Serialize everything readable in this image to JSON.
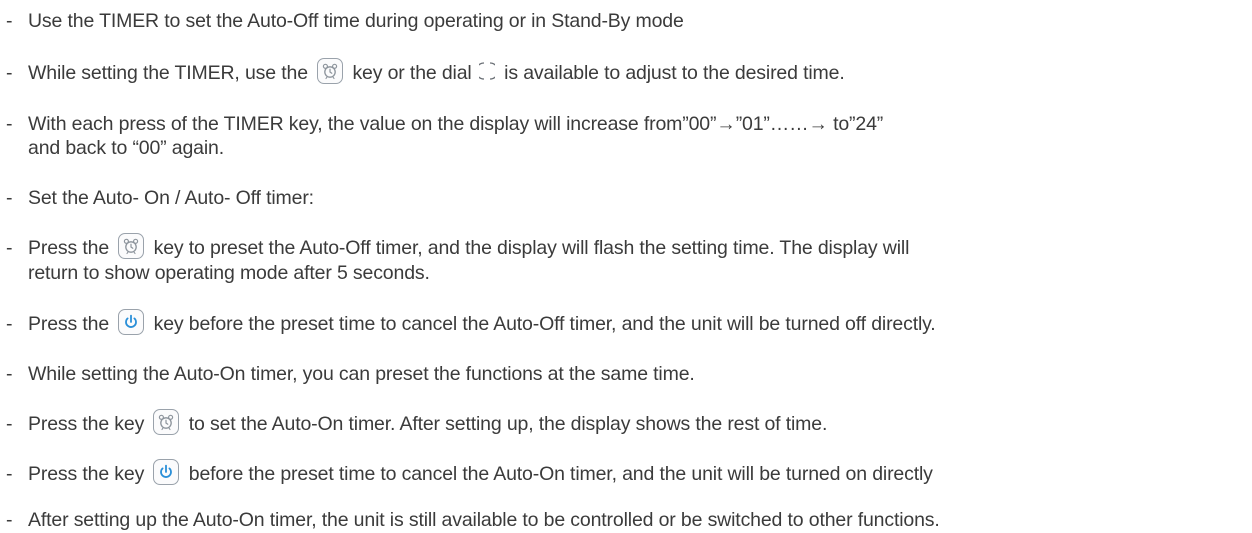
{
  "bullet_dash": "-",
  "lines": [
    {
      "text": "Use the TIMER to set the Auto-Off time during operating or in Stand-By mode"
    },
    {
      "before": "While setting the TIMER, use the",
      "middle": "key or the dial",
      "after": "is available to adjust to the desired time.",
      "icon": "timer-key-icon",
      "icon2": "dial-icon"
    },
    {
      "text": "With each press of the TIMER key, the value on the display will increase from”00”→”01”……→ to”24”",
      "cont": "and back  to “00” again."
    },
    {
      "text": "Set the Auto- On / Auto- Off timer:"
    },
    {
      "before": "Press the",
      "after": "key to preset the Auto-Off timer, and the display will flash the setting time.  The display will",
      "cont": "return to show operating mode after 5 seconds.",
      "icon": "timer-key-icon"
    },
    {
      "before": "Press the",
      "after": "key before the preset time to cancel the Auto-Off timer, and the unit will be turned off directly.",
      "icon": "power-key-icon"
    },
    {
      "text": "While setting the Auto-On timer, you can preset the functions at the same time."
    },
    {
      "before": "Press the key",
      "after": "to set the Auto-On timer. After setting up, the display shows the rest of time.",
      "icon": "timer-key-icon"
    },
    {
      "before": "Press the key",
      "after": "before the preset time to cancel the Auto-On timer, and the unit will be turned on directly",
      "icon": "power-key-icon"
    },
    {
      "text": "After setting up the Auto-On timer, the unit is still available to be controlled or be switched to other functions."
    }
  ],
  "colors": {
    "text": "#3b3b3b",
    "icon_stroke": "#9aa2ab",
    "power_blue": "#2a8fd8"
  }
}
